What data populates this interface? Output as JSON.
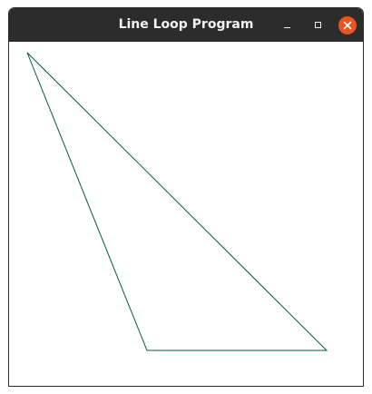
{
  "window": {
    "title": "Line Loop Program",
    "controls": {
      "minimize": "minimize-icon",
      "maximize": "maximize-icon",
      "close": "close-icon"
    },
    "close_color": "#e95420",
    "titlebar_color": "#2c2c2c"
  },
  "drawing": {
    "type": "line-loop",
    "color": "#005a4a",
    "background": "#ffffff"
  }
}
